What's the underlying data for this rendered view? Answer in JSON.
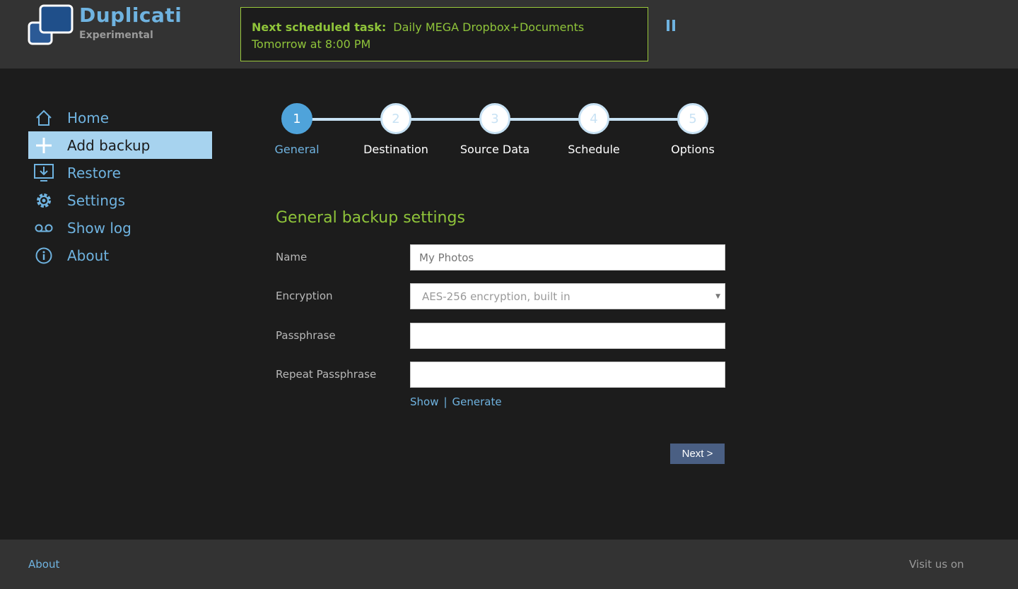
{
  "header": {
    "brand_title": "Duplicati",
    "brand_subtitle": "Experimental",
    "notice_label": "Next scheduled task:",
    "notice_text": "Daily MEGA Dropbox+Documents Tomorrow at 8:00 PM",
    "pause_icon": "pause-icon"
  },
  "sidebar": {
    "items": [
      {
        "label": "Home",
        "icon": "home-icon"
      },
      {
        "label": "Add backup",
        "icon": "plus-icon",
        "active": true
      },
      {
        "label": "Restore",
        "icon": "restore-icon"
      },
      {
        "label": "Settings",
        "icon": "gear-icon"
      },
      {
        "label": "Show log",
        "icon": "log-icon"
      },
      {
        "label": "About",
        "icon": "info-icon"
      }
    ]
  },
  "stepper": {
    "steps": [
      {
        "number": "1",
        "label": "General",
        "active": true
      },
      {
        "number": "2",
        "label": "Destination"
      },
      {
        "number": "3",
        "label": "Source Data"
      },
      {
        "number": "4",
        "label": "Schedule"
      },
      {
        "number": "5",
        "label": "Options"
      }
    ]
  },
  "form": {
    "title": "General backup settings",
    "name_label": "Name",
    "name_placeholder": "My Photos",
    "encryption_label": "Encryption",
    "encryption_value": "AES-256 encryption, built in",
    "passphrase_label": "Passphrase",
    "repeat_label": "Repeat Passphrase",
    "show_link": "Show",
    "separator": "|",
    "generate_link": "Generate",
    "next_button": "Next >"
  },
  "footer": {
    "about": "About",
    "visit": "Visit us on"
  },
  "colors": {
    "accent_blue": "#6fb3e0",
    "accent_green": "#8fc43a",
    "active_nav_bg": "#a7d3ef",
    "button_bg": "#4a5f83"
  }
}
